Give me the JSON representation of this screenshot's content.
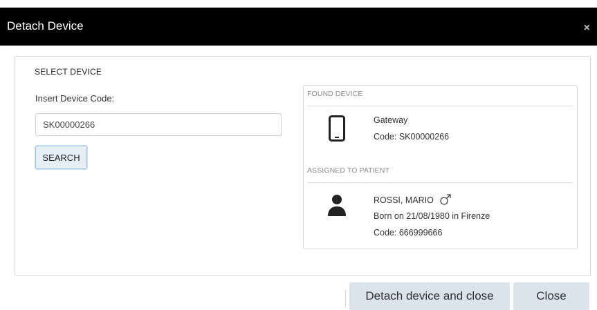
{
  "dialog": {
    "title": "Detach Device",
    "close_glyph": "×"
  },
  "select_device": {
    "section_title": "SELECT DEVICE",
    "field_label": "Insert Device Code:",
    "code_value": "SK00000266",
    "search_label": "SEARCH"
  },
  "found_device": {
    "heading": "FOUND DEVICE",
    "icon": "smartphone-icon",
    "device_type": "Gateway",
    "device_code": "Code: SK00000266"
  },
  "assigned_patient": {
    "heading": "ASSIGNED TO PATIENT",
    "icon": "person-icon",
    "gender_icon": "male-icon",
    "name": "ROSSI, MARIO",
    "birth": "Born on 21/08/1980 in Firenze",
    "code": "Code: 666999666"
  },
  "footer": {
    "detach_label": "Detach device and close",
    "close_label": "Close"
  },
  "colors": {
    "titlebar_bg": "#000000",
    "button_bg": "#dbe3eb",
    "search_border": "#9cc1e8"
  }
}
